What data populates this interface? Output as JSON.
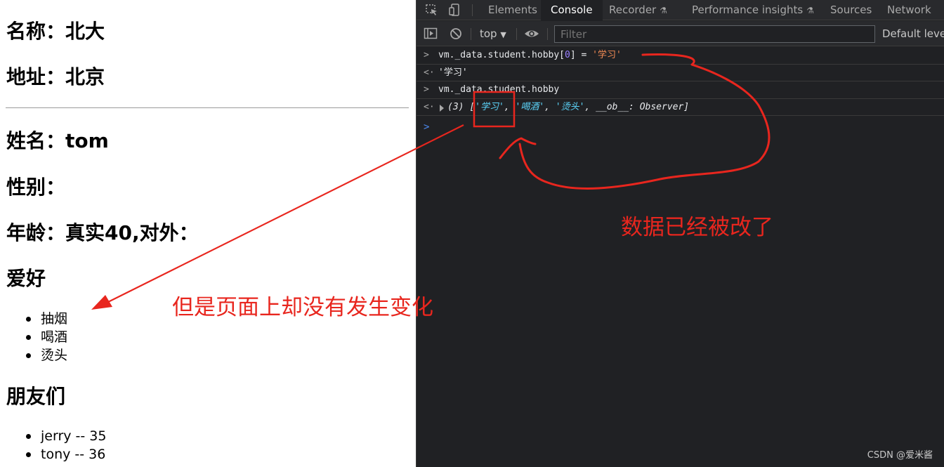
{
  "page": {
    "name_line": "名称：北大",
    "address_line": "地址：北京",
    "student_name_line": "姓名：tom",
    "gender_line": "性别：",
    "age_line": "年龄：真实40,对外：",
    "hobby_heading": "爱好",
    "hobbies": [
      "抽烟",
      "喝酒",
      "烫头"
    ],
    "friends_heading": "朋友们",
    "friends": [
      "jerry -- 35",
      "tony -- 36"
    ]
  },
  "devtools": {
    "tabs": [
      "Elements",
      "Console",
      "Recorder",
      "Performance insights",
      "Sources",
      "Network"
    ],
    "active_tab": "Console",
    "context": "top",
    "filter_placeholder": "Filter",
    "levels_label": "Default levels",
    "console": {
      "line1": {
        "prefix": ">",
        "code": "vm._data.student.hobby[",
        "index": "0",
        "code_end": "] = ",
        "value": "'学习'"
      },
      "line2": {
        "prefix": "<·",
        "result": "'学习'"
      },
      "line3": {
        "prefix": ">",
        "code": "vm._data.student.hobby"
      },
      "line4": {
        "prefix": "<·",
        "count": "(3)",
        "open": "[",
        "item1": "'学习'",
        "sep1": ", ",
        "item2": "'喝酒'",
        "sep2": ", ",
        "item3": "'烫头'",
        "rest": ", __ob__: Observer]"
      }
    },
    "prompt_symbol": ">"
  },
  "annotations": {
    "left_note": "但是页面上却没有发生变化",
    "right_note": "数据已经被改了",
    "color": "#e8261e"
  },
  "watermark": "CSDN @爱米酱",
  "icons": [
    "inspect-element-icon",
    "device-toolbar-icon",
    "sidebar-toggle-icon",
    "clear-console-icon",
    "eye-icon",
    "flask-icon"
  ]
}
